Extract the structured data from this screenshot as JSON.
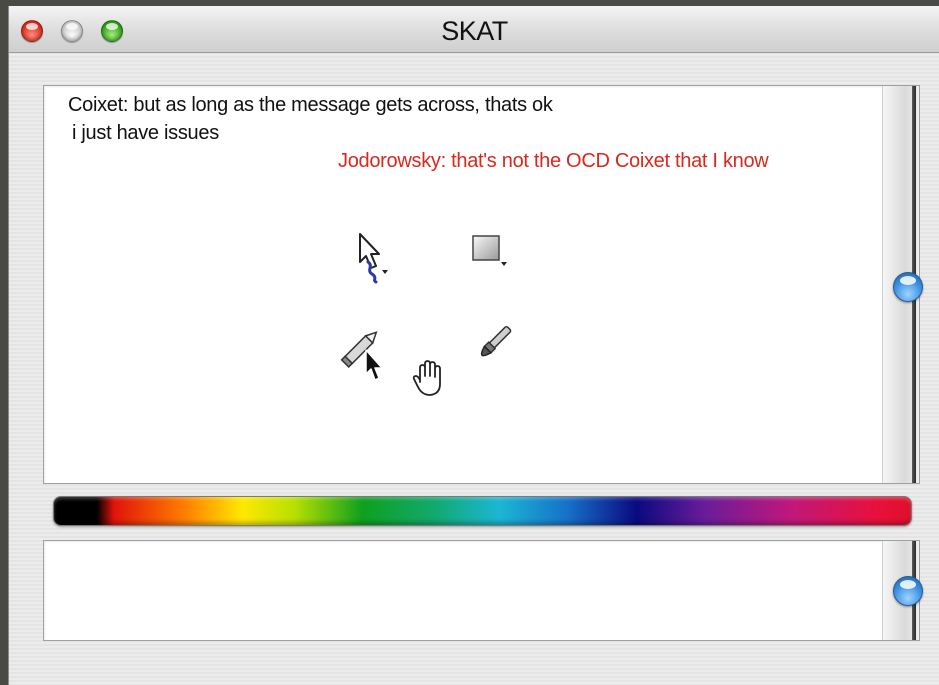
{
  "window": {
    "title": "SKAT"
  },
  "chat": {
    "messages": [
      {
        "text": "Coixet: but as long as the message gets across, thats ok",
        "color": "#111111"
      },
      {
        "text": "i just have issues",
        "color": "#111111"
      },
      {
        "text": "Jodorowsky: that's not the OCD Coixet that I know",
        "color": "#d9281e"
      }
    ]
  },
  "tool_palette": {
    "tools": [
      "arrow-cursor-icon",
      "rectangle-tool-icon",
      "pencil-tool-icon",
      "brush-tool-icon",
      "hand-tool-icon"
    ]
  },
  "color_slider": {
    "selected_color": "#000000",
    "colors": [
      "#000000",
      "#e0140a",
      "#ff7a00",
      "#ffe800",
      "#0fa01e",
      "#1cb6d4",
      "#1670c8",
      "#0a0a80",
      "#6a1c9a",
      "#c0187a",
      "#e8103c"
    ]
  },
  "input": {
    "value": ""
  },
  "accent": {
    "scroll_thumb": "#3b8fe0",
    "close_button": "#d8291a",
    "maximize_button": "#2f9b17"
  }
}
